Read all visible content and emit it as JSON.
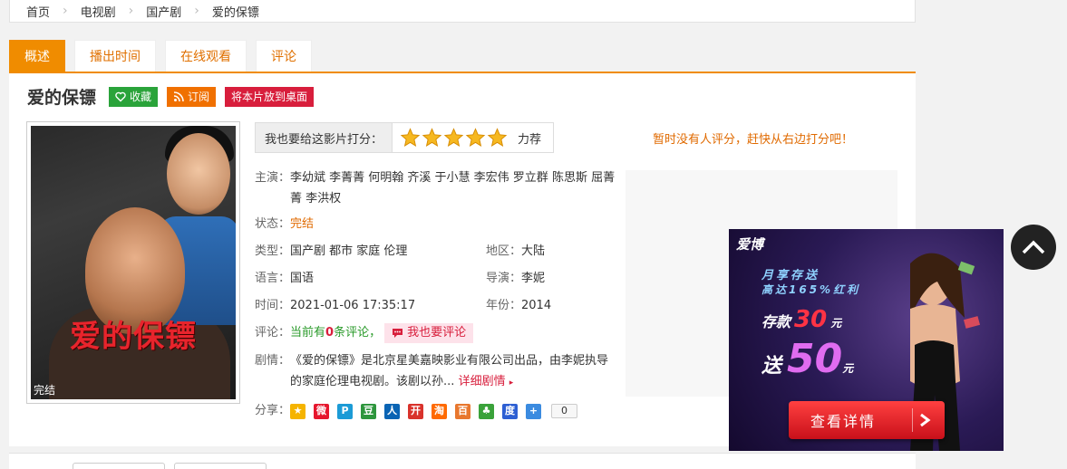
{
  "breadcrumb": [
    "首页",
    "电视剧",
    "国产剧",
    "爱的保镖"
  ],
  "tabs": [
    "概述",
    "播出时间",
    "在线观看",
    "评论"
  ],
  "title": "爱的保镖",
  "buttons": {
    "favorite": "收藏",
    "subscribe": "订阅",
    "desktop": "将本片放到桌面"
  },
  "poster": {
    "title": "爱的保镖",
    "tag": "完结"
  },
  "rating": {
    "label": "我也要给这影片打分：",
    "stars": 5,
    "text": "力荐"
  },
  "no_rating": "暂时没有人评分，赶快从右边打分吧！",
  "info": {
    "cast_label": "主演：",
    "cast": "李幼斌 李菁菁 何明翰 齐溪 于小慧 李宏伟 罗立群 陈思斯 屈菁菁 李洪权",
    "status_label": "状态：",
    "status": "完结",
    "type_label": "类型：",
    "type": "国产剧 都市  家庭  伦理",
    "region_label": "地区：",
    "region": "大陆",
    "lang_label": "语言：",
    "lang": "国语",
    "director_label": "导演：",
    "director": "李妮",
    "time_label": "时间：",
    "time": "2021-01-06 17:35:17",
    "year_label": "年份：",
    "year": "2014",
    "comment_label": "评论：",
    "comment_pre": "当前有",
    "comment_count": "0",
    "comment_post": "条评论，",
    "comment_btn": "我也要评论",
    "plot_label": "剧情：",
    "plot": "《爱的保镖》是北京星美嘉映影业有限公司出品，由李妮执导的家庭伦理电视剧。该剧以孙...",
    "plot_more": "详细剧情",
    "share_label": "分享：",
    "share_count": "0"
  },
  "share_icons": [
    {
      "name": "qzone-icon",
      "color": "#f5b400",
      "glyph": "★"
    },
    {
      "name": "weibo-icon",
      "color": "#e6162d",
      "glyph": "微"
    },
    {
      "name": "tqq-icon",
      "color": "#1c9bd6",
      "glyph": "P"
    },
    {
      "name": "douban-icon",
      "color": "#2e963d",
      "glyph": "豆"
    },
    {
      "name": "renren-icon",
      "color": "#0a64b4",
      "glyph": "人"
    },
    {
      "name": "kaixin-icon",
      "color": "#d9332c",
      "glyph": "开"
    },
    {
      "name": "taobao-icon",
      "color": "#ff6a00",
      "glyph": "淘"
    },
    {
      "name": "baidu-space-icon",
      "color": "#e8772e",
      "glyph": "百"
    },
    {
      "name": "clover-icon",
      "color": "#3aa23a",
      "glyph": "♣"
    },
    {
      "name": "baidu-icon",
      "color": "#2d5fd3",
      "glyph": "度"
    },
    {
      "name": "more-share-icon",
      "color": "#3b8be0",
      "glyph": "+"
    }
  ],
  "ad": {
    "brand": "爱博",
    "line1": "月享存送",
    "line2": "高达165%红利",
    "deposit": "存款",
    "deposit_num": "30",
    "deposit_unit": "元",
    "send": "送",
    "send_num": "50",
    "send_unit": "元",
    "button": "查看详情"
  },
  "colors": {
    "accent": "#f08c00",
    "green": "#2aa33a",
    "red": "#d81e3c"
  }
}
